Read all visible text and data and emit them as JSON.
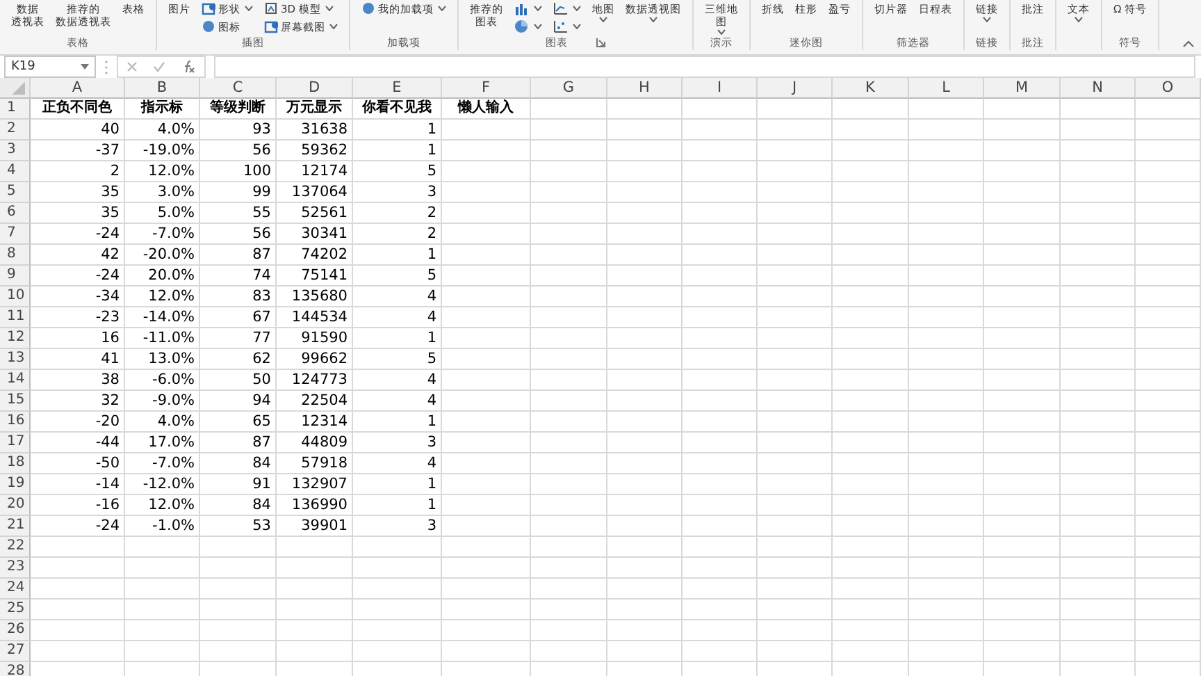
{
  "ribbon": {
    "groups": [
      {
        "label": "表格",
        "columns": [
          [
            {
              "kind": "large",
              "lines": [
                "数据",
                "透视表"
              ],
              "dropdown": false
            }
          ],
          [
            {
              "kind": "large",
              "lines": [
                "推荐的",
                "数据透视表"
              ],
              "dropdown": false
            }
          ],
          [
            {
              "kind": "large",
              "label": "表格",
              "dropdown": false
            }
          ]
        ]
      },
      {
        "label": "插图",
        "columns": [
          [
            {
              "kind": "large",
              "label": "图片",
              "dropdown": false
            }
          ],
          [
            {
              "kind": "small",
              "label": "形状",
              "dropdown": true
            },
            {
              "kind": "small",
              "label": "图标",
              "dropdown": false
            }
          ],
          [
            {
              "kind": "small",
              "label": "3D 模型",
              "dropdown": true
            },
            {
              "kind": "small",
              "label": "屏幕截图",
              "dropdown": true
            }
          ]
        ]
      },
      {
        "label": "加载项",
        "columns": [
          [
            {
              "kind": "small",
              "label": "我的加载项",
              "dropdown": true
            }
          ]
        ]
      },
      {
        "label": "图表",
        "launcher": true,
        "columns": [
          [
            {
              "kind": "large",
              "lines": [
                "推荐的",
                "图表"
              ],
              "dropdown": false
            }
          ],
          [
            {
              "kind": "icon",
              "dropdown": true
            },
            {
              "kind": "icon",
              "dropdown": true
            }
          ],
          [
            {
              "kind": "icon",
              "dropdown": true
            },
            {
              "kind": "icon",
              "dropdown": true
            }
          ],
          [
            {
              "kind": "large",
              "label": "地图",
              "dropdown": true
            }
          ],
          [
            {
              "kind": "large",
              "label": "数据透视图",
              "dropdown": true
            }
          ]
        ]
      },
      {
        "label": "演示",
        "columns": [
          [
            {
              "kind": "large",
              "lines": [
                "三维地",
                "图"
              ],
              "dropdown": true
            }
          ]
        ]
      },
      {
        "label": "迷你图",
        "columns": [
          [
            {
              "kind": "large",
              "label": "折线",
              "dropdown": false
            }
          ],
          [
            {
              "kind": "large",
              "label": "柱形",
              "dropdown": false
            }
          ],
          [
            {
              "kind": "large",
              "label": "盈亏",
              "dropdown": false
            }
          ]
        ]
      },
      {
        "label": "筛选器",
        "columns": [
          [
            {
              "kind": "large",
              "label": "切片器",
              "dropdown": false
            }
          ],
          [
            {
              "kind": "large",
              "label": "日程表",
              "dropdown": false
            }
          ]
        ]
      },
      {
        "label": "链接",
        "columns": [
          [
            {
              "kind": "large",
              "label": "链接",
              "dropdown": true
            }
          ]
        ]
      },
      {
        "label": "批注",
        "columns": [
          [
            {
              "kind": "large",
              "label": "批注",
              "dropdown": false
            }
          ]
        ]
      },
      {
        "columns": [
          [
            {
              "kind": "large",
              "label": "文本",
              "dropdown": true
            }
          ]
        ]
      },
      {
        "label": "符号",
        "columns": [
          [
            {
              "kind": "large",
              "label": "Ω 符号",
              "dropdown": false
            }
          ]
        ]
      }
    ]
  },
  "name_box": "K19",
  "columns": [
    "A",
    "B",
    "C",
    "D",
    "E",
    "F",
    "G",
    "H",
    "I",
    "J",
    "K",
    "L",
    "M",
    "N",
    "O"
  ],
  "header_row": {
    "number": "1",
    "cells": [
      "正负不同色",
      "指示标",
      "等级判断",
      "万元显示",
      "你看不见我",
      "懒人输入"
    ]
  },
  "rows": [
    {
      "number": "2",
      "cells": [
        "40",
        "4.0%",
        "93",
        "31638",
        "1"
      ]
    },
    {
      "number": "3",
      "cells": [
        "-37",
        "-19.0%",
        "56",
        "59362",
        "1"
      ]
    },
    {
      "number": "4",
      "cells": [
        "2",
        "12.0%",
        "100",
        "12174",
        "5"
      ]
    },
    {
      "number": "5",
      "cells": [
        "35",
        "3.0%",
        "99",
        "137064",
        "3"
      ]
    },
    {
      "number": "6",
      "cells": [
        "35",
        "5.0%",
        "55",
        "52561",
        "2"
      ]
    },
    {
      "number": "7",
      "cells": [
        "-24",
        "-7.0%",
        "56",
        "30341",
        "2"
      ]
    },
    {
      "number": "8",
      "cells": [
        "42",
        "-20.0%",
        "87",
        "74202",
        "1"
      ]
    },
    {
      "number": "9",
      "cells": [
        "-24",
        "20.0%",
        "74",
        "75141",
        "5"
      ]
    },
    {
      "number": "10",
      "cells": [
        "-34",
        "12.0%",
        "83",
        "135680",
        "4"
      ]
    },
    {
      "number": "11",
      "cells": [
        "-23",
        "-14.0%",
        "67",
        "144534",
        "4"
      ]
    },
    {
      "number": "12",
      "cells": [
        "16",
        "-11.0%",
        "77",
        "91590",
        "1"
      ]
    },
    {
      "number": "13",
      "cells": [
        "41",
        "13.0%",
        "62",
        "99662",
        "5"
      ]
    },
    {
      "number": "14",
      "cells": [
        "38",
        "-6.0%",
        "50",
        "124773",
        "4"
      ]
    },
    {
      "number": "15",
      "cells": [
        "32",
        "-9.0%",
        "94",
        "22504",
        "4"
      ]
    },
    {
      "number": "16",
      "cells": [
        "-20",
        "4.0%",
        "65",
        "12314",
        "1"
      ]
    },
    {
      "number": "17",
      "cells": [
        "-44",
        "17.0%",
        "87",
        "44809",
        "3"
      ]
    },
    {
      "number": "18",
      "cells": [
        "-50",
        "-7.0%",
        "84",
        "57918",
        "4"
      ]
    },
    {
      "number": "19",
      "cells": [
        "-14",
        "-12.0%",
        "91",
        "132907",
        "1"
      ]
    },
    {
      "number": "20",
      "cells": [
        "-16",
        "12.0%",
        "84",
        "136990",
        "1"
      ]
    },
    {
      "number": "21",
      "cells": [
        "-24",
        "-1.0%",
        "53",
        "39901",
        "3"
      ]
    },
    {
      "number": "22",
      "cells": []
    },
    {
      "number": "23",
      "cells": []
    },
    {
      "number": "24",
      "cells": []
    },
    {
      "number": "25",
      "cells": []
    },
    {
      "number": "26",
      "cells": []
    },
    {
      "number": "27",
      "cells": []
    },
    {
      "number": "28",
      "cells": []
    }
  ]
}
